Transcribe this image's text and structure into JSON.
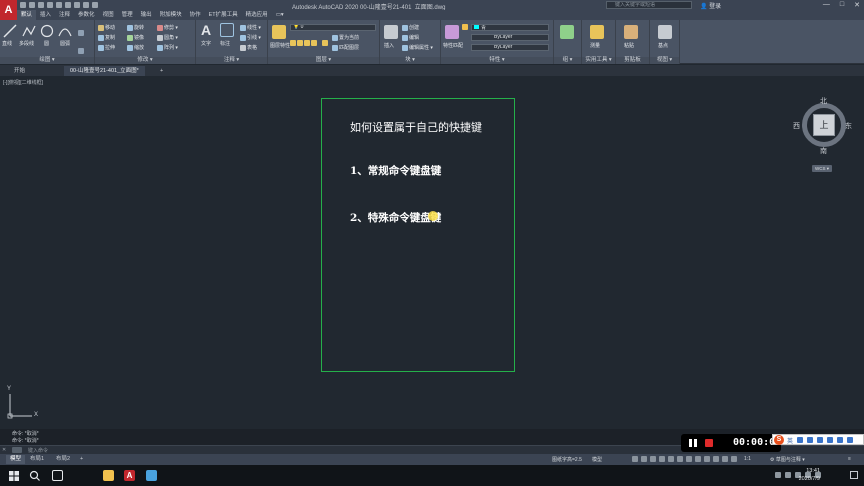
{
  "app": {
    "logo_letter": "A",
    "title": "Autodesk AutoCAD 2020    00-山隆壹号21-401_立面图.dwg",
    "search_placeholder": "键入关键字或短语",
    "login_label": "登录",
    "window_controls": [
      "—",
      "□",
      "✕"
    ]
  },
  "ribbon_tabs": [
    "默认",
    "插入",
    "注释",
    "参数化",
    "视图",
    "管理",
    "输出",
    "附加模块",
    "协作",
    "ET扩展工具",
    "精选应用",
    "▭▾"
  ],
  "ribbon_active_tab": 0,
  "ribbon_panels": {
    "draw": {
      "title": "绘图 ▾",
      "buttons": [
        "直线",
        "多段线",
        "圆",
        "圆弧"
      ]
    },
    "modify": {
      "title": "修改 ▾",
      "buttons": [
        "移动",
        "旋转",
        "修剪 ▾",
        "复制",
        "镜像",
        "圆角 ▾",
        "拉伸",
        "缩放",
        "阵列 ▾"
      ]
    },
    "annotation": {
      "title": "注释 ▾",
      "buttons": [
        "文字",
        "标注",
        "线性 ▾",
        "引线 ▾",
        "表格"
      ]
    },
    "layers": {
      "title": "图层 ▾",
      "buttons": [
        "图层特性",
        "置为当前",
        "匹配图层"
      ],
      "current_layer": "0"
    },
    "block": {
      "title": "块 ▾",
      "buttons": [
        "插入",
        "创建",
        "编辑",
        "编辑属性 ▾"
      ]
    },
    "properties": {
      "title": "特性 ▾",
      "buttons": [
        "特性匹配"
      ],
      "color": "青",
      "linetype": "ByLayer",
      "lineweight": "ByLayer"
    },
    "groups": {
      "title": "组 ▾"
    },
    "utilities": {
      "title": "实用工具 ▾",
      "buttons": [
        "测量"
      ]
    },
    "clipboard": {
      "title": "剪贴板",
      "buttons": [
        "粘贴"
      ]
    },
    "view": {
      "title": "视图 ▾",
      "buttons": [
        "基点"
      ]
    }
  },
  "file_tabs": [
    {
      "label": "开始",
      "active": false
    },
    {
      "label": "00-山隆壹号21-401_立面图*",
      "active": true
    },
    {
      "label": "+",
      "active": false
    }
  ],
  "viewport": {
    "label": "[-][俯视][二维线框]",
    "drawing": {
      "title": "如何设置属于自己的快捷键",
      "items": [
        "1、常规命令键盘键",
        "2、特殊命令键盘键"
      ],
      "frame_color": "#25b04a"
    },
    "viewcube": {
      "north": "北",
      "south": "南",
      "east": "东",
      "west": "西",
      "face": "上",
      "wcs": "WCS ▾"
    },
    "ucs": {
      "x": "X",
      "y": "Y"
    }
  },
  "command": {
    "history": [
      "命令: *取消*",
      "命令: *取消*"
    ],
    "placeholder": "键入命令",
    "close": "✕"
  },
  "status": {
    "layout_tabs": [
      {
        "label": "模型",
        "active": true
      },
      {
        "label": "布局1",
        "active": false
      },
      {
        "label": "布局2",
        "active": false
      },
      {
        "label": "+",
        "active": false
      }
    ],
    "annotation_scale": "图纸字高=2.5",
    "space": "模型",
    "scale": "1:1",
    "workspace": "草图与注释 ▾"
  },
  "recorder": {
    "time": "00:00:00"
  },
  "ime": {
    "logo": "S",
    "lang": "英"
  },
  "taskbar": {
    "time": "13:41",
    "date": "2020/7/9"
  },
  "colors": {
    "accent_red": "#c1272d",
    "frame_green": "#25b04a",
    "background": "#212830"
  }
}
